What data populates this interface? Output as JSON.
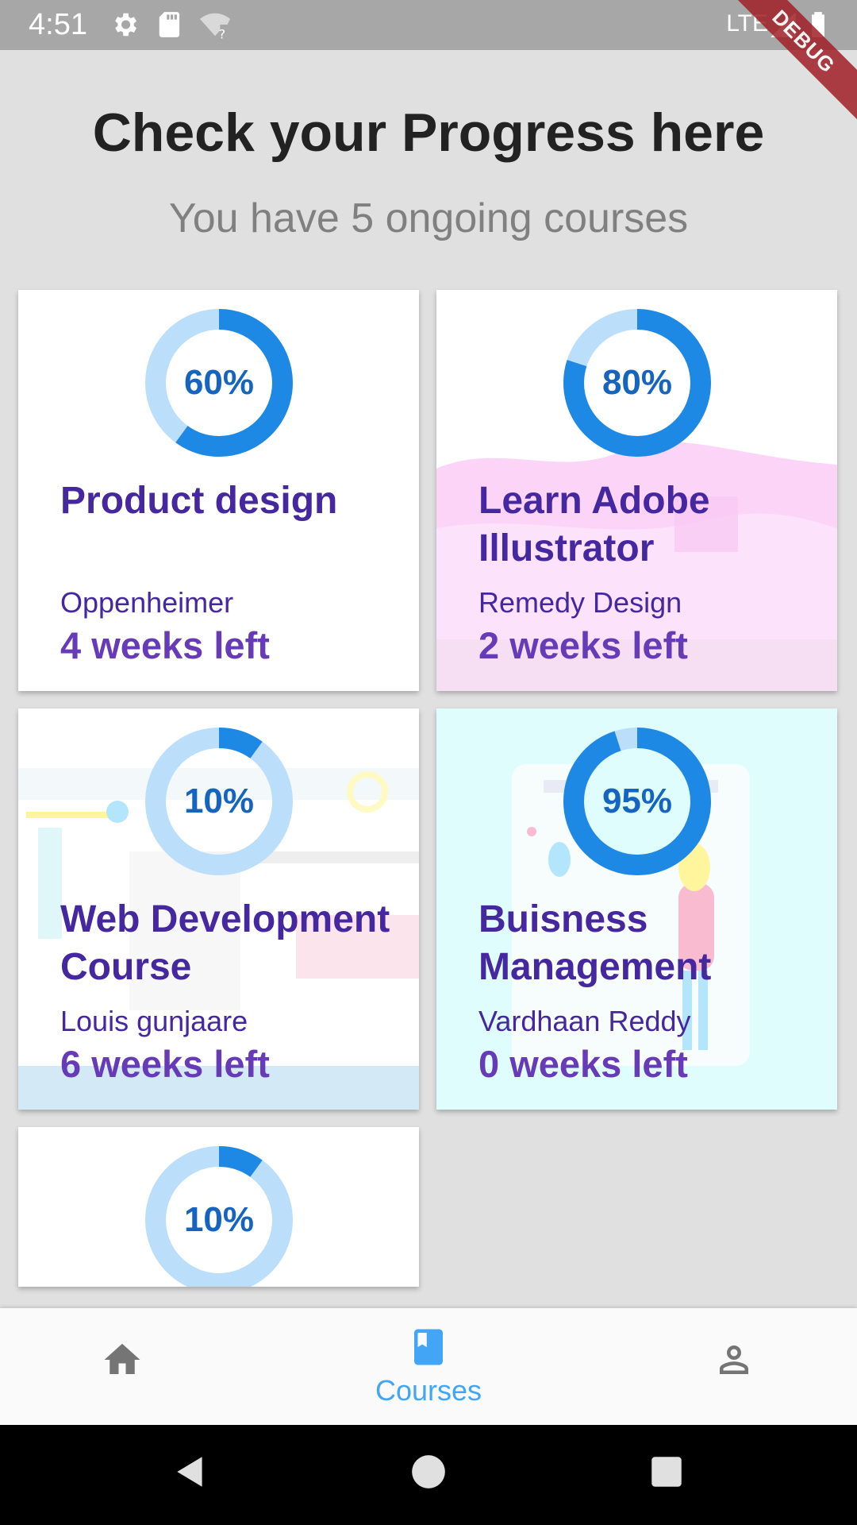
{
  "status_bar": {
    "time": "4:51",
    "network": "LTE",
    "debug": "DEBUG"
  },
  "header": {
    "title": "Check your Progress here",
    "subtitle": "You have 5 ongoing courses"
  },
  "colors": {
    "ring_fill": "#1e88e5",
    "ring_track": "#bbdefb",
    "title": "#4527a0",
    "weeks": "#673ab7",
    "nav_active": "#42a5f5"
  },
  "courses": [
    {
      "percent": 60,
      "percent_label": "60%",
      "title": "Product design",
      "author": "Oppenheimer",
      "weeks": "4 weeks left"
    },
    {
      "percent": 80,
      "percent_label": "80%",
      "title": "Learn Adobe Illustrator",
      "author": "Remedy Design",
      "weeks": "2 weeks left"
    },
    {
      "percent": 10,
      "percent_label": "10%",
      "title": "Web Development Course",
      "author": "Louis gunjaare",
      "weeks": "6 weeks left"
    },
    {
      "percent": 95,
      "percent_label": "95%",
      "title": "Buisness Management",
      "author": "Vardhaan Reddy",
      "weeks": "0 weeks left"
    },
    {
      "percent": 10,
      "percent_label": "10%"
    }
  ],
  "bottom_nav": {
    "items": [
      {
        "icon": "home-icon",
        "label": ""
      },
      {
        "icon": "book-icon",
        "label": "Courses"
      },
      {
        "icon": "person-icon",
        "label": ""
      }
    ],
    "active": 1
  }
}
